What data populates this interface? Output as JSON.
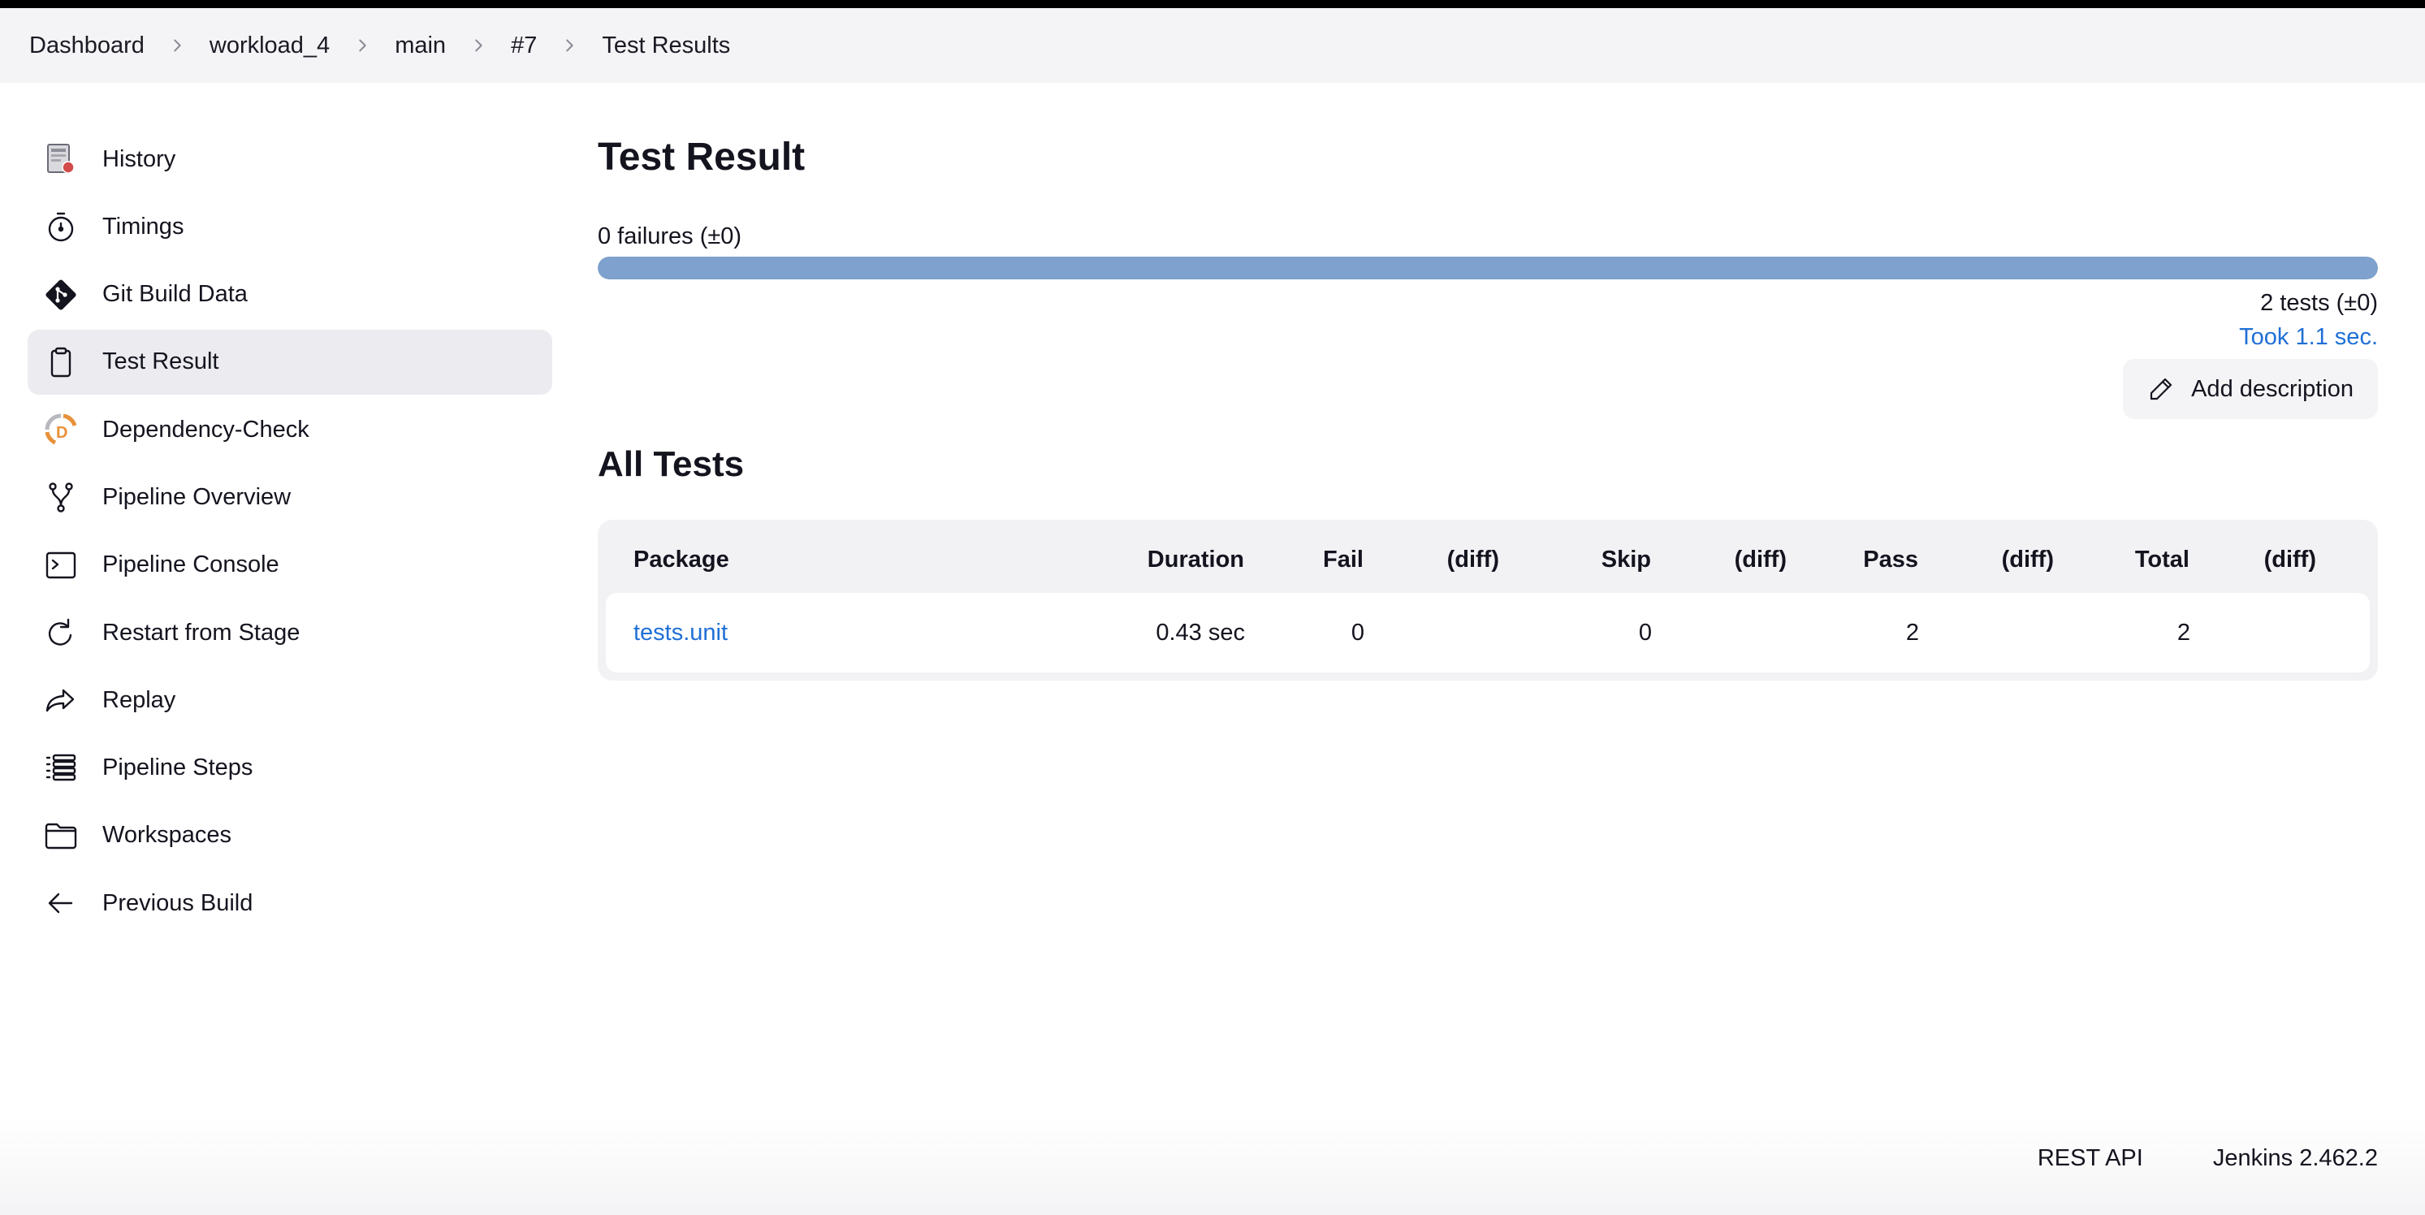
{
  "breadcrumb": [
    {
      "label": "Dashboard"
    },
    {
      "label": "workload_4"
    },
    {
      "label": "main"
    },
    {
      "label": "#7"
    },
    {
      "label": "Test Results"
    }
  ],
  "sidebar": {
    "items": [
      {
        "label": "History",
        "icon": "history-icon",
        "active": false
      },
      {
        "label": "Timings",
        "icon": "timer-icon",
        "active": false
      },
      {
        "label": "Git Build Data",
        "icon": "git-icon",
        "active": false
      },
      {
        "label": "Test Result",
        "icon": "clipboard-icon",
        "active": true
      },
      {
        "label": "Dependency-Check",
        "icon": "dependency-check-icon",
        "active": false
      },
      {
        "label": "Pipeline Overview",
        "icon": "pipeline-branch-icon",
        "active": false
      },
      {
        "label": "Pipeline Console",
        "icon": "terminal-icon",
        "active": false
      },
      {
        "label": "Restart from Stage",
        "icon": "restart-icon",
        "active": false
      },
      {
        "label": "Replay",
        "icon": "replay-icon",
        "active": false
      },
      {
        "label": "Pipeline Steps",
        "icon": "list-icon",
        "active": false
      },
      {
        "label": "Workspaces",
        "icon": "folder-icon",
        "active": false
      },
      {
        "label": "Previous Build",
        "icon": "arrow-left-icon",
        "active": false
      }
    ]
  },
  "main": {
    "title": "Test Result",
    "failures_text": "0 failures (±0)",
    "pass_fraction": 1.0,
    "tests_text": "2 tests (±0)",
    "took_text": "Took 1.1 sec.",
    "add_description_label": "Add description",
    "all_tests_title": "All Tests",
    "table": {
      "headers": [
        "Package",
        "Duration",
        "Fail",
        "(diff)",
        "Skip",
        "(diff)",
        "Pass",
        "(diff)",
        "Total",
        "(diff)"
      ],
      "rows": [
        {
          "package": "tests.unit",
          "duration": "0.43 sec",
          "fail": "0",
          "fail_diff": "",
          "skip": "0",
          "skip_diff": "",
          "pass": "2",
          "pass_diff": "",
          "total": "2",
          "total_diff": ""
        }
      ]
    }
  },
  "footer": {
    "rest_api": "REST API",
    "version": "Jenkins 2.462.2"
  },
  "colors": {
    "accent": "#1f6fd6",
    "progress_pass": "#7ea1cd",
    "active_item_bg": "#ececf0"
  }
}
